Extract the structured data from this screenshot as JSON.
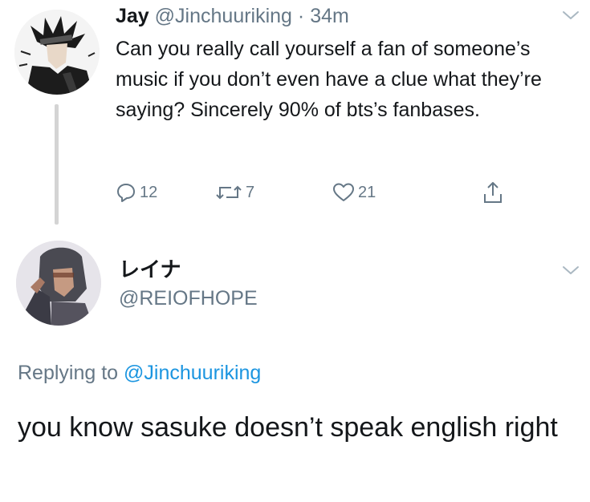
{
  "tweet": {
    "author_name": "Jay",
    "author_handle": "@Jinchuuriking",
    "separator": "·",
    "time": "34m",
    "text": "Can you really call yourself a fan of someone’s music if you don’t even have a clue what they’re saying? Sincerely 90% of bts’s fanbases.",
    "reply_count": "12",
    "retweet_count": "7",
    "like_count": "21",
    "icons": {
      "reply": "reply-icon",
      "retweet": "retweet-icon",
      "like": "heart-icon",
      "share": "share-icon",
      "menu": "chevron-down-icon"
    }
  },
  "reply": {
    "author_name": "レイナ",
    "author_handle": "@REIOFHOPE",
    "replying_prefix": "Replying to ",
    "replying_to": "@Jinchuuriking",
    "text": "you know sasuke doesn’t speak english right"
  },
  "colors": {
    "text": "#14171a",
    "secondary": "#657786",
    "link": "#1b95e0",
    "thread_line": "#d4d4d4"
  }
}
